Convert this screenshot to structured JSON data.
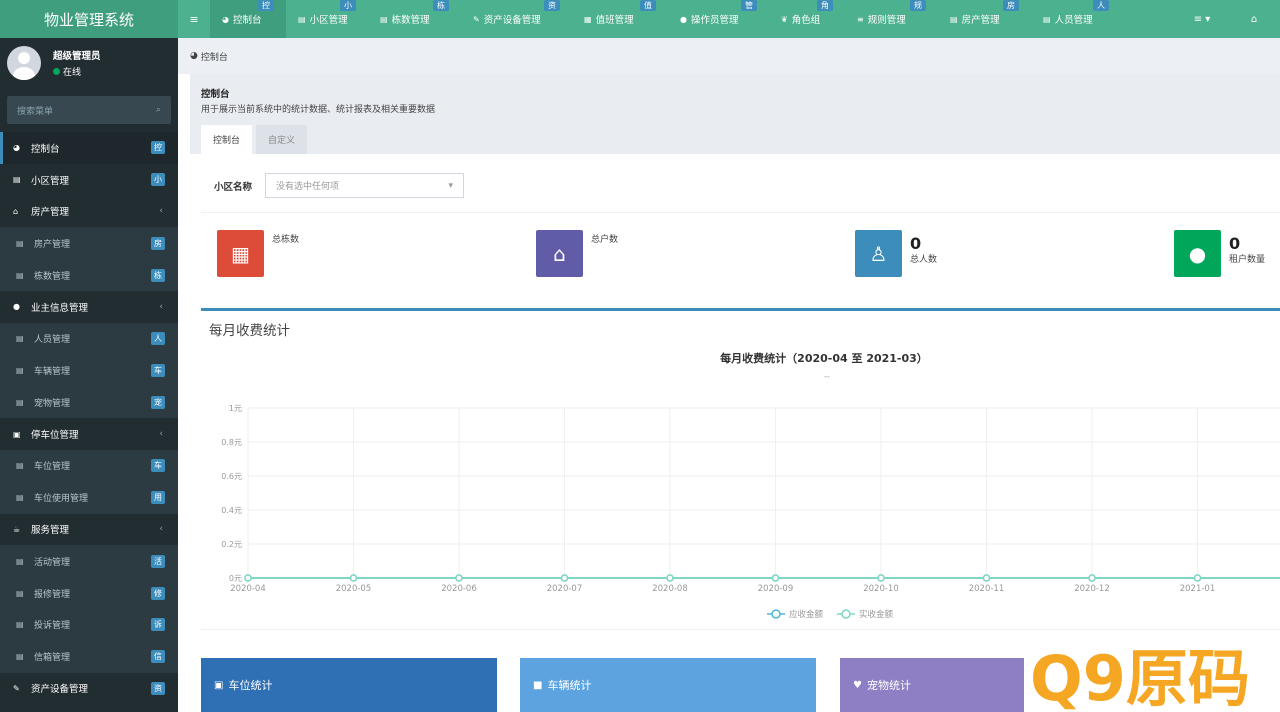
{
  "app": {
    "title": "物业管理系统"
  },
  "topnav": {
    "tabs": [
      {
        "label": "控制台",
        "badge": "控",
        "icon": "dashboard-icon"
      },
      {
        "label": "小区管理",
        "badge": "小",
        "icon": "list-icon"
      },
      {
        "label": "栋数管理",
        "badge": "栋",
        "icon": "list-icon"
      },
      {
        "label": "资产设备管理",
        "badge": "资",
        "icon": "wrench-icon"
      },
      {
        "label": "值班管理",
        "badge": "值",
        "icon": "calendar-icon"
      },
      {
        "label": "操作员管理",
        "badge": "管",
        "icon": "user-icon"
      },
      {
        "label": "角色组",
        "badge": "角",
        "icon": "users-icon"
      },
      {
        "label": "规则管理",
        "badge": "规",
        "icon": "bars-icon"
      },
      {
        "label": "房产管理",
        "badge": "房",
        "icon": "list-icon"
      },
      {
        "label": "人员管理",
        "badge": "人",
        "icon": "list-icon"
      }
    ]
  },
  "user": {
    "name": "超级管理员",
    "status": "在线"
  },
  "sidebar": {
    "search_placeholder": "搜索菜单",
    "items": [
      {
        "label": "控制台",
        "badge": "控",
        "type": "top",
        "icon": "dashboard-icon"
      },
      {
        "label": "小区管理",
        "badge": "小",
        "type": "top",
        "icon": "list-icon"
      },
      {
        "label": "房产管理",
        "type": "group",
        "icon": "home-icon"
      },
      {
        "label": "房产管理",
        "badge": "房",
        "type": "sub",
        "icon": "list-icon"
      },
      {
        "label": "栋数管理",
        "badge": "栋",
        "type": "sub",
        "icon": "list-icon"
      },
      {
        "label": "业主信息管理",
        "type": "group",
        "icon": "user-icon"
      },
      {
        "label": "人员管理",
        "badge": "人",
        "type": "sub",
        "icon": "list-icon"
      },
      {
        "label": "车辆管理",
        "badge": "车",
        "type": "sub",
        "icon": "list-icon"
      },
      {
        "label": "宠物管理",
        "badge": "宠",
        "type": "sub",
        "icon": "list-icon"
      },
      {
        "label": "停车位管理",
        "type": "group",
        "icon": "film-icon"
      },
      {
        "label": "车位管理",
        "badge": "车",
        "type": "sub",
        "icon": "list-icon"
      },
      {
        "label": "车位使用管理",
        "badge": "用",
        "type": "sub",
        "icon": "list-icon"
      },
      {
        "label": "服务管理",
        "type": "group",
        "icon": "coffee-icon"
      },
      {
        "label": "活动管理",
        "badge": "活",
        "type": "sub",
        "icon": "list-icon"
      },
      {
        "label": "报修管理",
        "badge": "修",
        "type": "sub",
        "icon": "list-icon"
      },
      {
        "label": "投诉管理",
        "badge": "诉",
        "type": "sub",
        "icon": "list-icon"
      },
      {
        "label": "信箱管理",
        "badge": "信",
        "type": "sub",
        "icon": "list-icon"
      },
      {
        "label": "资产设备管理",
        "badge": "资",
        "type": "top",
        "icon": "wrench-icon"
      }
    ]
  },
  "breadcrumb": "控制台",
  "page": {
    "title": "控制台",
    "description": "用于展示当前系统中的统计数据、统计报表及相关重要数据",
    "tabs": [
      "控制台",
      "自定义"
    ]
  },
  "filter": {
    "label": "小区名称",
    "placeholder": "没有选中任何项"
  },
  "stats": [
    {
      "label": "总栋数",
      "value": "",
      "color": "#dd4b39",
      "icon": "building-icon"
    },
    {
      "label": "总户数",
      "value": "",
      "color": "#605ca8",
      "icon": "home-icon"
    },
    {
      "label": "总人数",
      "value": "0",
      "color": "#3c8dbc",
      "icon": "person-icon"
    },
    {
      "label": "租户数量",
      "value": "0",
      "color": "#00a65a",
      "icon": "user-icon"
    }
  ],
  "chart_box_title": "每月收费统计",
  "chart_data": {
    "type": "line",
    "title": "每月收费统计（2020-04 至 2021-03）",
    "subtitle": "--",
    "categories": [
      "2020-04",
      "2020-05",
      "2020-06",
      "2020-07",
      "2020-08",
      "2020-09",
      "2020-10",
      "2020-11",
      "2020-12",
      "2021-01"
    ],
    "y_ticks": [
      "0元",
      "0.2元",
      "0.4元",
      "0.6元",
      "0.8元",
      "1元"
    ],
    "ylim": [
      0,
      1
    ],
    "series": [
      {
        "name": "应收金额",
        "values": [
          0,
          0,
          0,
          0,
          0,
          0,
          0,
          0,
          0,
          0
        ],
        "color": "#4fb8d8"
      },
      {
        "name": "实收金额",
        "values": [
          0,
          0,
          0,
          0,
          0,
          0,
          0,
          0,
          0,
          0
        ],
        "color": "#7fd6c4"
      }
    ],
    "grid": true,
    "legend": "bottom"
  },
  "bottom_boxes": [
    {
      "label": "车位统计",
      "color": "#2f70b5",
      "icon": "film-icon"
    },
    {
      "label": "车辆统计",
      "color": "#5ca3e0",
      "icon": "truck-icon"
    },
    {
      "label": "宠物统计",
      "color": "#8e7fc4",
      "icon": "heart-icon"
    }
  ],
  "watermark": "Q9原码"
}
